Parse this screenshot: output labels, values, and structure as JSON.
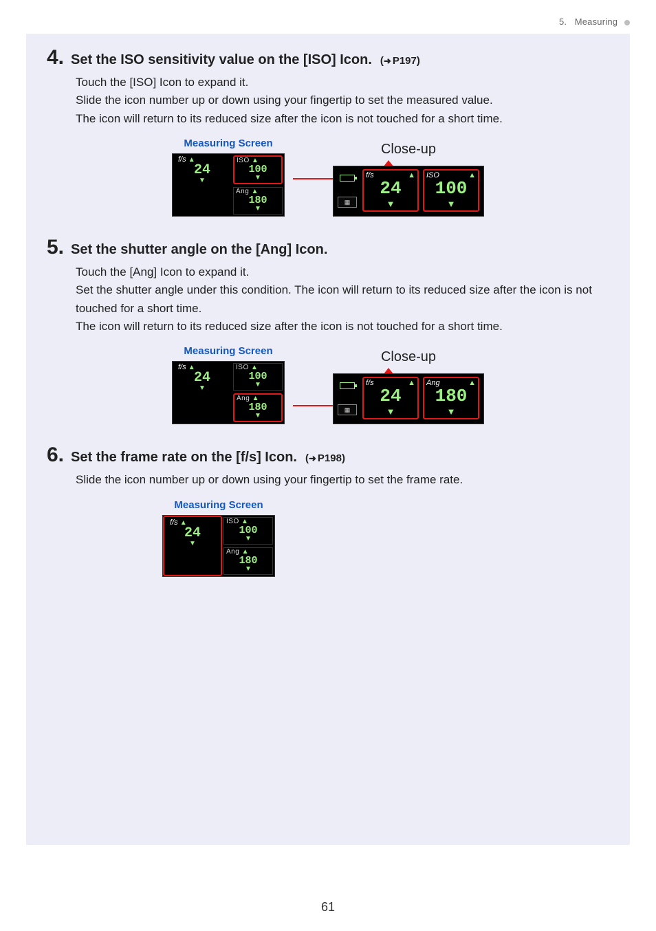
{
  "running_head": {
    "section_num": "5.",
    "section_title": "Measuring"
  },
  "steps": [
    {
      "num": "4.",
      "title": "Set the ISO sensitivity value on the [ISO] Icon.",
      "ref": "P197",
      "body": [
        "Touch the [ISO] Icon to expand it.",
        "Slide the icon number up or down using your fingertip to set the measured value.",
        "The icon will return to its reduced size after the icon is not touched for a short time."
      ],
      "fig": {
        "caption": "Measuring Screen",
        "closeup_label": "Close-up",
        "small": {
          "fs_label": "f/s",
          "fs_value": "24",
          "iso_label": "ISO",
          "iso_value": "100",
          "ang_label": "Ang",
          "ang_value": "180",
          "highlight": "iso"
        },
        "closeup": {
          "left_label": "f/s",
          "left_value": "24",
          "right_label": "ISO",
          "right_value": "100",
          "highlight_both": true
        }
      }
    },
    {
      "num": "5.",
      "title": "Set the shutter angle on the [Ang] Icon.",
      "ref": null,
      "body": [
        "Touch the [Ang] Icon to expand it.",
        "Set the shutter angle under this condition. The icon will return to its reduced size after the icon is not touched for a short time.",
        "The icon will return to its reduced size after the icon is not touched for a short time."
      ],
      "fig": {
        "caption": "Measuring Screen",
        "closeup_label": "Close-up",
        "small": {
          "fs_label": "f/s",
          "fs_value": "24",
          "iso_label": "ISO",
          "iso_value": "100",
          "ang_label": "Ang",
          "ang_value": "180",
          "highlight": "ang"
        },
        "closeup": {
          "left_label": "f/s",
          "left_value": "24",
          "right_label": "Ang",
          "right_value": "180",
          "highlight_both": true
        }
      }
    },
    {
      "num": "6.",
      "title": "Set the frame rate on the [f/s] Icon.",
      "ref": "P198",
      "body": [
        "Slide the icon number up or down using your fingertip to set the frame rate."
      ],
      "fig": {
        "caption": "Measuring Screen",
        "closeup_label": null,
        "small": {
          "fs_label": "f/s",
          "fs_value": "24",
          "iso_label": "ISO",
          "iso_value": "100",
          "ang_label": "Ang",
          "ang_value": "180",
          "highlight": "fs"
        },
        "closeup": null
      }
    }
  ],
  "page_number": "61"
}
